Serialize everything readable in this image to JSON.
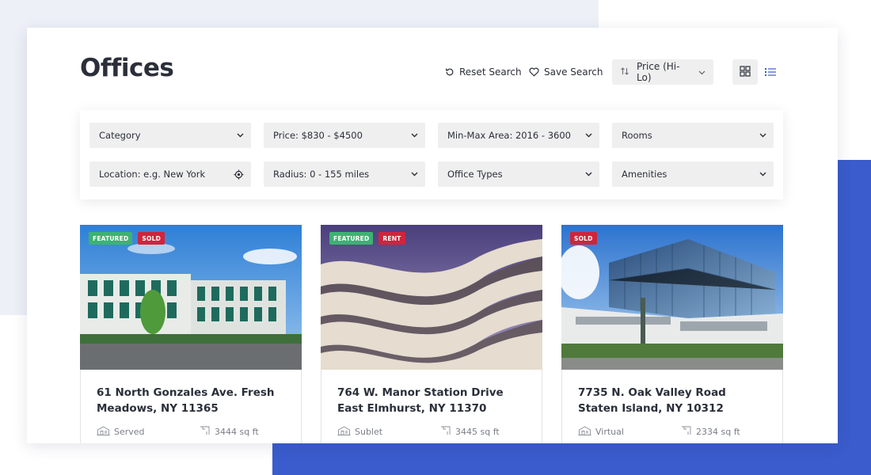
{
  "colors": {
    "accent_blue": "#3a5ccc",
    "featured_badge": "#3cb371",
    "status_badge": "#d0243c",
    "control_bg": "#efefef"
  },
  "header": {
    "title": "Offices",
    "reset_label": "Reset Search",
    "save_label": "Save Search",
    "sort_label": "Price (Hi-Lo)",
    "icons": [
      "reset-icon",
      "heart-icon",
      "sort-arrows-icon",
      "chevron-down-icon",
      "grid-view-icon",
      "list-view-icon"
    ]
  },
  "filters": {
    "category": "Category",
    "price": "Price: $830 - $4500",
    "area": "Min-Max Area: 2016 - 3600",
    "rooms": "Rooms",
    "location_placeholder": "Location: e.g. New York",
    "radius": "Radius: 0 - 155 miles",
    "office_types": "Office Types",
    "amenities": "Amenities"
  },
  "listings": [
    {
      "badges": [
        "FEATURED",
        "SOLD"
      ],
      "address": "61 North Gonzales Ave. Fresh Meadows, NY 11365",
      "type": "Served",
      "area": "3444 sq ft"
    },
    {
      "badges": [
        "FEATURED",
        "RENT"
      ],
      "address": "764 W. Manor Station Drive East Elmhurst, NY 11370",
      "type": "Sublet",
      "area": "3445 sq ft"
    },
    {
      "badges": [
        "SOLD"
      ],
      "address": "7735 N. Oak Valley Road Staten Island, NY 10312",
      "type": "Virtual",
      "area": "2334 sq ft"
    }
  ]
}
